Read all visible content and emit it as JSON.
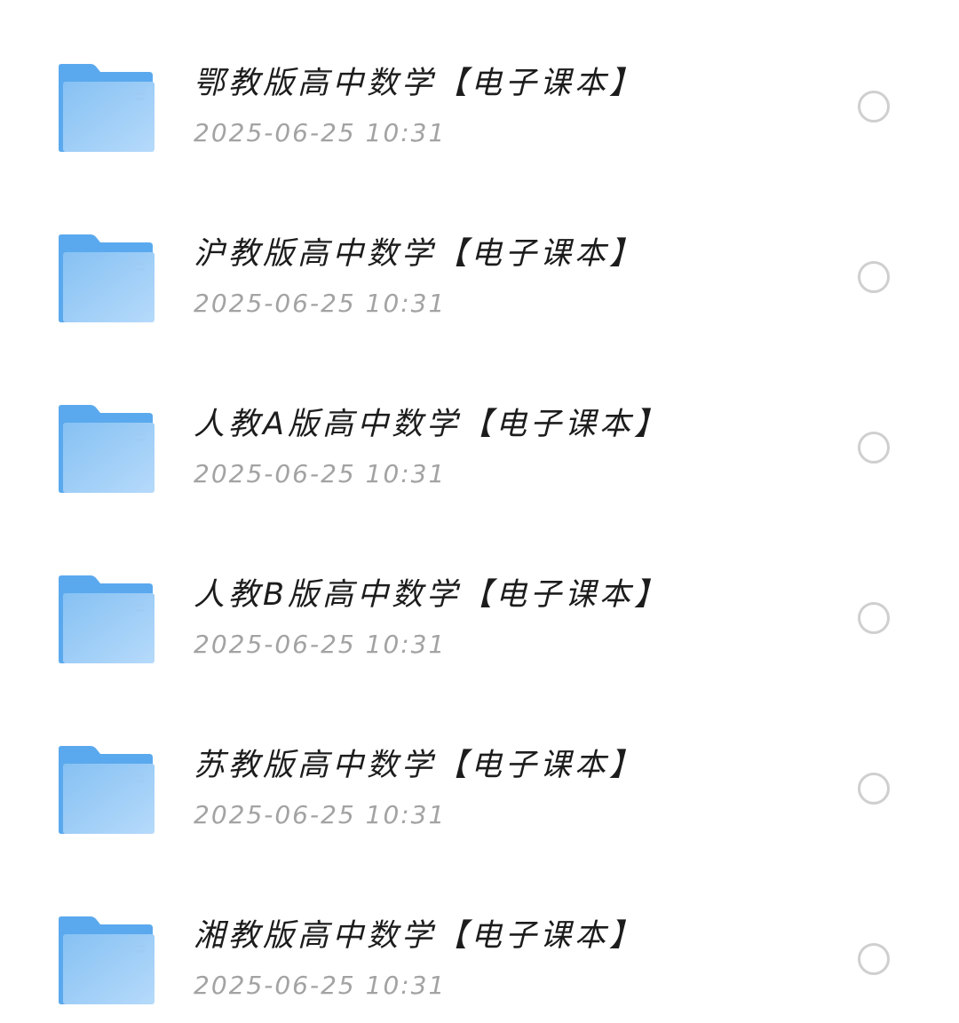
{
  "files": [
    {
      "name": "鄂教版高中数学【电子课本】",
      "date": "2025-06-25 10:31",
      "icon": "folder-icon"
    },
    {
      "name": "沪教版高中数学【电子课本】",
      "date": "2025-06-25 10:31",
      "icon": "folder-icon"
    },
    {
      "name": "人教A版高中数学【电子课本】",
      "date": "2025-06-25 10:31",
      "icon": "folder-icon"
    },
    {
      "name": "人教B版高中数学【电子课本】",
      "date": "2025-06-25 10:31",
      "icon": "folder-icon"
    },
    {
      "name": "苏教版高中数学【电子课本】",
      "date": "2025-06-25 10:31",
      "icon": "folder-icon"
    },
    {
      "name": "湘教版高中数学【电子课本】",
      "date": "2025-06-25 10:31",
      "icon": "folder-icon"
    }
  ],
  "colors": {
    "folder_back": "#5aa9ee",
    "folder_front_start": "#8cc4f4",
    "folder_front_end": "#b4d9fb",
    "radio_border": "#cfcfcf",
    "name_text": "#1c1c1c",
    "date_text": "#a3a3a3"
  }
}
